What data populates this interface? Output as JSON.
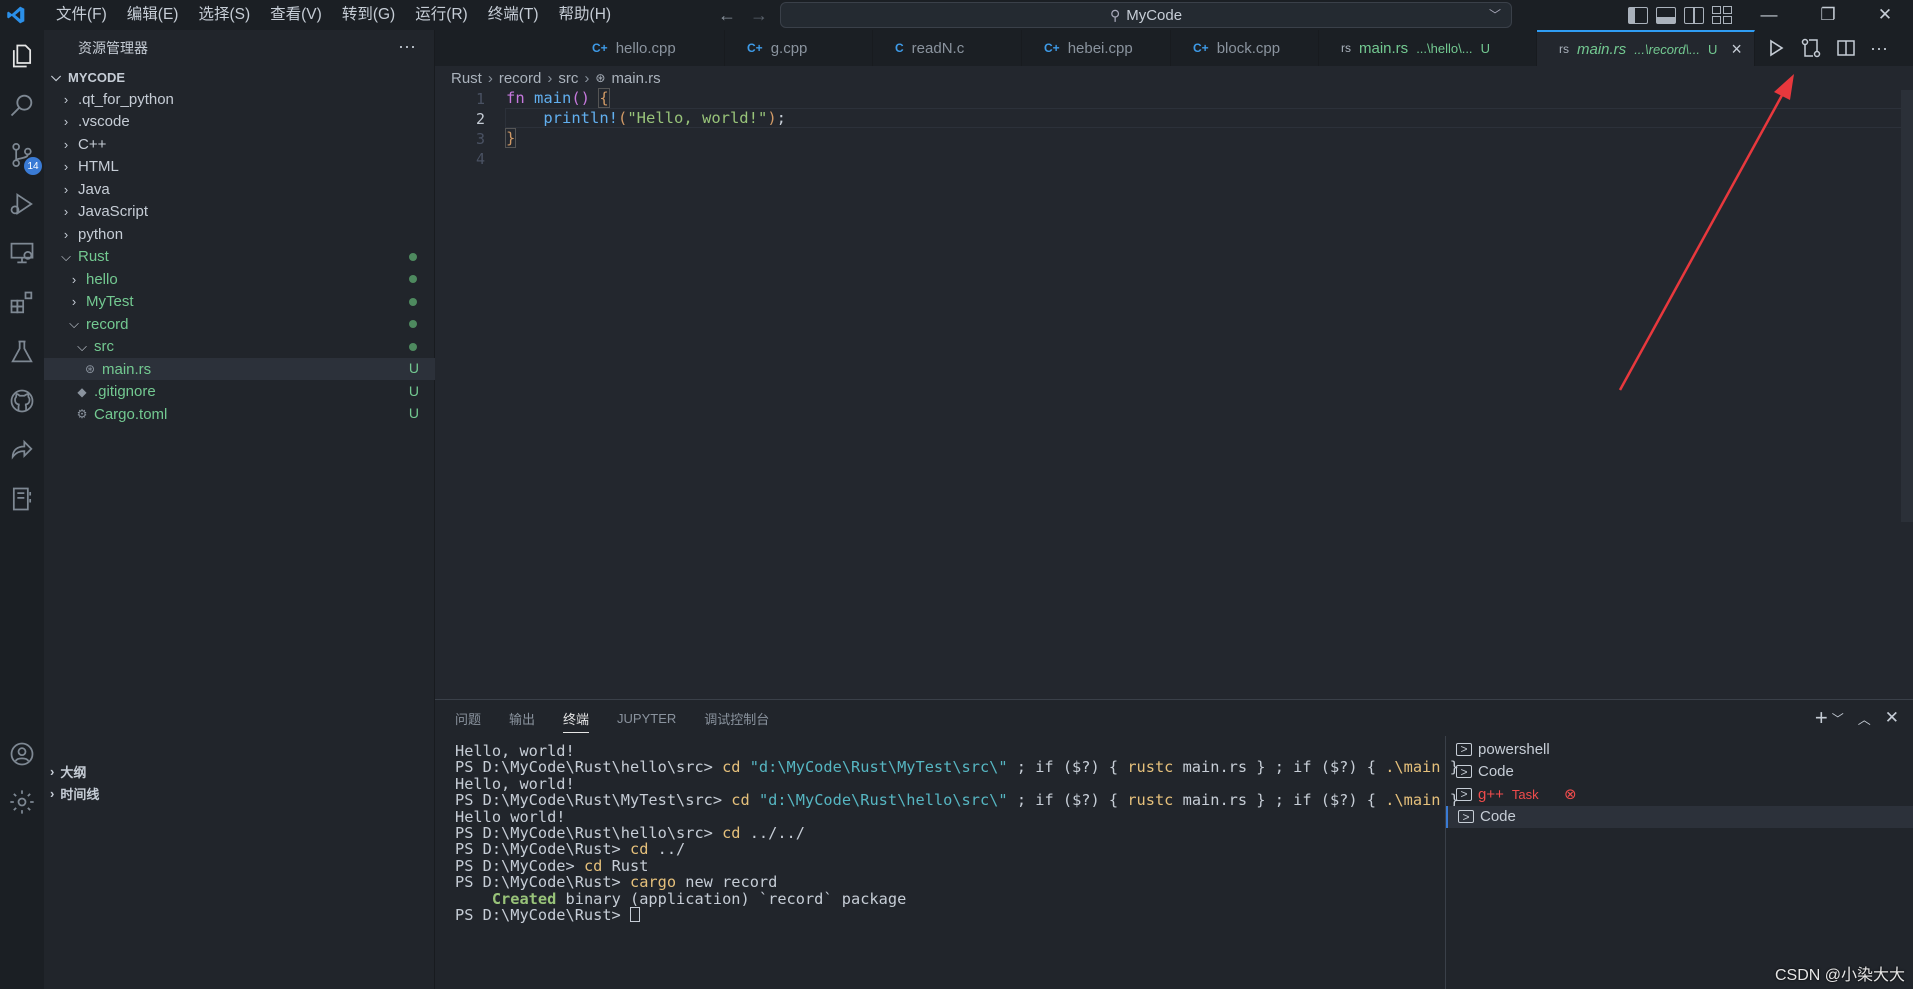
{
  "window": {
    "title": "MyCode"
  },
  "menu": [
    "文件(F)",
    "编辑(E)",
    "选择(S)",
    "查看(V)",
    "转到(G)",
    "运行(R)",
    "终端(T)",
    "帮助(H)"
  ],
  "activity_badge": "14",
  "sidebar": {
    "header": "资源管理器",
    "root": "MYCODE",
    "items": [
      {
        "label": ".qt_for_python",
        "depth": 1,
        "open": false,
        "status": ""
      },
      {
        "label": ".vscode",
        "depth": 1,
        "open": false,
        "status": ""
      },
      {
        "label": "C++",
        "depth": 1,
        "open": false,
        "status": ""
      },
      {
        "label": "HTML",
        "depth": 1,
        "open": false,
        "status": ""
      },
      {
        "label": "Java",
        "depth": 1,
        "open": false,
        "status": ""
      },
      {
        "label": "JavaScript",
        "depth": 1,
        "open": false,
        "status": ""
      },
      {
        "label": "python",
        "depth": 1,
        "open": false,
        "status": ""
      },
      {
        "label": "Rust",
        "depth": 1,
        "open": true,
        "status": ""
      },
      {
        "label": "hello",
        "depth": 2,
        "open": false,
        "status": ""
      },
      {
        "label": "MyTest",
        "depth": 2,
        "open": false,
        "status": ""
      },
      {
        "label": "record",
        "depth": 2,
        "open": true,
        "status": ""
      },
      {
        "label": "src",
        "depth": 3,
        "open": true,
        "status": ""
      },
      {
        "label": "main.rs",
        "depth": 4,
        "file": true,
        "status": "U"
      },
      {
        "label": ".gitignore",
        "depth": 3,
        "file": true,
        "status": "U"
      },
      {
        "label": "Cargo.toml",
        "depth": 3,
        "file": true,
        "status": "U"
      }
    ],
    "outline_label": "大纲",
    "timeline_label": "时间线"
  },
  "tabs": [
    {
      "icon": "C+",
      "label": "hello.cpp"
    },
    {
      "icon": "C+",
      "label": "g.cpp"
    },
    {
      "icon": "C",
      "label": "readN.c"
    },
    {
      "icon": "C+",
      "label": "hebei.cpp"
    },
    {
      "icon": "C+",
      "label": "block.cpp"
    },
    {
      "icon": "rs",
      "label": "main.rs",
      "sub": "...\\hello\\...",
      "status": "U"
    },
    {
      "icon": "rs",
      "label": "main.rs",
      "sub": "...\\record\\...",
      "status": "U",
      "active": true
    }
  ],
  "breadcrumb": [
    "Rust",
    "record",
    "src",
    "main.rs"
  ],
  "code": {
    "line_numbers": [
      "1",
      "2",
      "3",
      "4"
    ],
    "fn_kw": "fn",
    "fn_name": "main",
    "parens": "()",
    "open_brace": "{",
    "macro": "println!",
    "arg": "\"Hello, world!\"",
    "close_brace": "}"
  },
  "panel": {
    "tabs": [
      "问题",
      "输出",
      "终端",
      "JUPYTER",
      "调试控制台"
    ],
    "active_tab": "终端",
    "terminal": {
      "l1": "Hello, world!",
      "l2_prompt": "PS D:\\MyCode\\Rust\\hello\\src> ",
      "l2_cmd": "cd",
      "l2_path": "\"d:\\MyCode\\Rust\\MyTest\\src\\\"",
      "l2_rest": " ; if ($?) { ",
      "l2_c2": "rustc",
      "l2_rest2": " main.rs } ; if ($?) { ",
      "l2_c3": ".\\main",
      "l2_end": " }",
      "l3": "Hello, world!",
      "l4_prompt": "PS D:\\MyCode\\Rust\\MyTest\\src> ",
      "l4_path": "\"d:\\MyCode\\Rust\\hello\\src\\\"",
      "l5": "Hello world!",
      "l6_prompt": "PS D:\\MyCode\\Rust\\hello\\src> ",
      "l6_cmd": "cd",
      "l6_arg": " ../../",
      "l7_prompt": "PS D:\\MyCode\\Rust> ",
      "l7_cmd": "cd",
      "l7_arg": " ../",
      "l8_prompt": "PS D:\\MyCode> ",
      "l8_cmd": "cd",
      "l8_arg": " Rust",
      "l9_prompt": "PS D:\\MyCode\\Rust> ",
      "l9_cmd": "cargo",
      "l9_arg": " new record",
      "l10_created": "Created",
      "l10_rest": " binary (application) `record` package",
      "l11_prompt": "PS D:\\MyCode\\Rust> "
    },
    "terminals": [
      {
        "label": "powershell"
      },
      {
        "label": "Code"
      },
      {
        "label": "g++",
        "task": "Task",
        "error": true
      },
      {
        "label": "Code",
        "selected": true
      }
    ]
  },
  "watermark": "CSDN @小染大大",
  "colors": {
    "accent": "#2f9df4",
    "git_untracked": "#73c991",
    "annotation_arrow": "#e8383d"
  }
}
